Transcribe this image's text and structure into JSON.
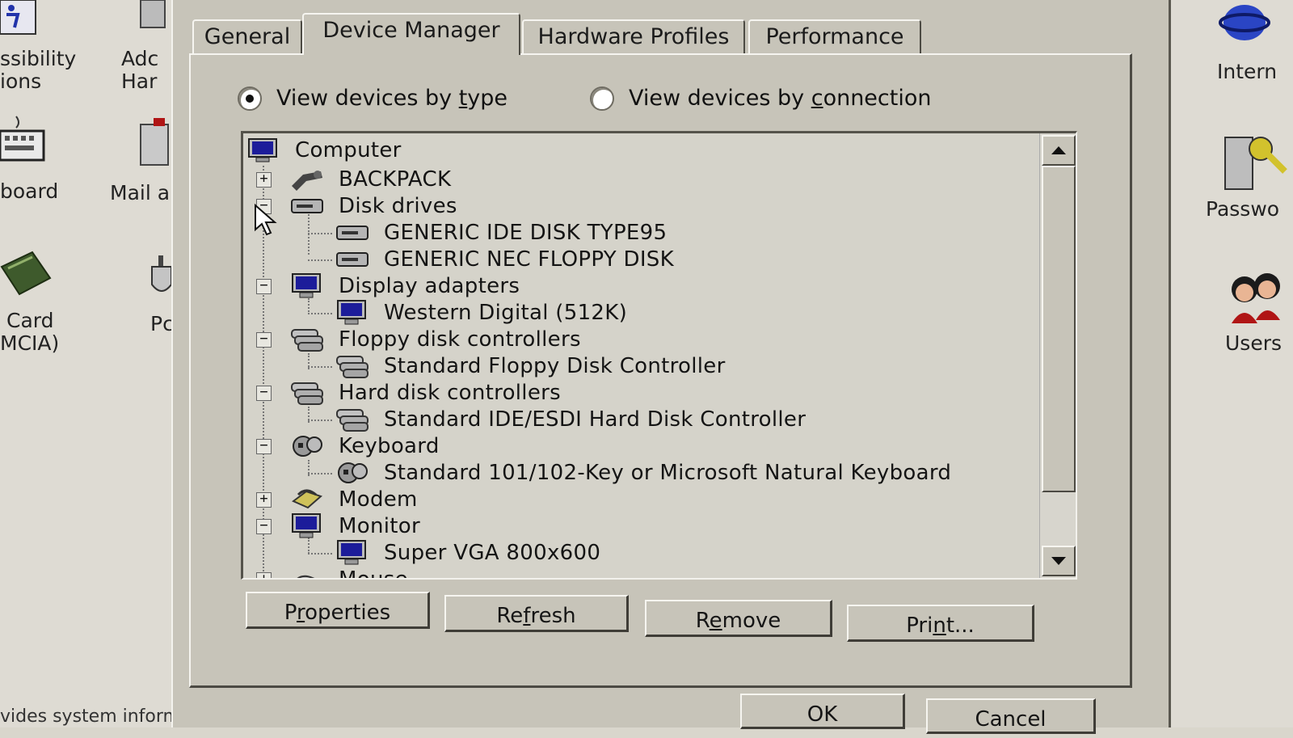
{
  "desktop": {
    "left_items": [
      {
        "label_top": "ssibility",
        "label_bottom": "ions",
        "icon": "accessibility-icon"
      },
      {
        "label_top": "Adc",
        "label_bottom": "Har",
        "icon": "add-hardware-icon"
      },
      {
        "label_top": "board",
        "label_bottom": "",
        "icon": "keyboard-icon"
      },
      {
        "label_top": "Mail a",
        "label_bottom": "",
        "icon": "mail-icon"
      },
      {
        "label_top": "Card",
        "label_bottom": "MCIA)",
        "icon": "pc-card-icon"
      },
      {
        "label_top": "Pc",
        "label_bottom": "",
        "icon": "power-icon"
      }
    ],
    "right_items": [
      {
        "label": "Intern",
        "icon": "internet-icon"
      },
      {
        "label": "Passwo",
        "icon": "passwords-icon"
      },
      {
        "label": "Users",
        "icon": "users-icon"
      }
    ],
    "status_text": "vides system inform"
  },
  "tabs": [
    {
      "label": "General",
      "active": false
    },
    {
      "label": "Device Manager",
      "active": true
    },
    {
      "label": "Hardware Profiles",
      "active": false
    },
    {
      "label": "Performance",
      "active": false
    }
  ],
  "view_options": {
    "by_type": {
      "prefix": "View devices by ",
      "underlined": "t",
      "suffix": "ype",
      "selected": true
    },
    "by_connection": {
      "prefix": "View devices by ",
      "underlined": "c",
      "suffix": "onnection",
      "selected": false
    }
  },
  "tree": {
    "root": "Computer",
    "rows": [
      {
        "label": "BACKPACK",
        "level": 1,
        "expander": "+",
        "icon": "backpack-icon"
      },
      {
        "label": "Disk drives",
        "level": 1,
        "expander": "−",
        "icon": "disk-drive-icon"
      },
      {
        "label": "GENERIC IDE  DISK TYPE95",
        "level": 2,
        "icon": "disk-drive-icon"
      },
      {
        "label": "GENERIC NEC  FLOPPY DISK",
        "level": 2,
        "icon": "disk-drive-icon"
      },
      {
        "label": "Display adapters",
        "level": 1,
        "expander": "−",
        "icon": "monitor-icon"
      },
      {
        "label": "Western Digital (512K)",
        "level": 2,
        "icon": "monitor-icon"
      },
      {
        "label": "Floppy disk controllers",
        "level": 1,
        "expander": "−",
        "icon": "controller-icon"
      },
      {
        "label": "Standard Floppy Disk Controller",
        "level": 2,
        "icon": "controller-icon"
      },
      {
        "label": "Hard disk controllers",
        "level": 1,
        "expander": "−",
        "icon": "controller-icon"
      },
      {
        "label": "Standard IDE/ESDI Hard Disk Controller",
        "level": 2,
        "icon": "controller-icon"
      },
      {
        "label": "Keyboard",
        "level": 1,
        "expander": "−",
        "icon": "keyboard-device-icon"
      },
      {
        "label": "Standard 101/102-Key or Microsoft Natural Keyboard",
        "level": 2,
        "icon": "keyboard-device-icon"
      },
      {
        "label": "Modem",
        "level": 1,
        "expander": "+",
        "icon": "modem-icon"
      },
      {
        "label": "Monitor",
        "level": 1,
        "expander": "−",
        "icon": "monitor-icon"
      },
      {
        "label": "Super VGA  800x600",
        "level": 2,
        "icon": "monitor-icon"
      },
      {
        "label": "Mouse",
        "level": 1,
        "expander": "+",
        "icon": "mouse-icon"
      }
    ]
  },
  "buttons": {
    "properties": {
      "prefix": "P",
      "underlined": "r",
      "suffix": "operties"
    },
    "refresh": {
      "prefix": "Re",
      "underlined": "f",
      "suffix": "resh"
    },
    "remove": {
      "prefix": "R",
      "underlined": "e",
      "suffix": "move"
    },
    "print": {
      "prefix": "Pri",
      "underlined": "n",
      "suffix": "t..."
    },
    "ok": "OK",
    "cancel": "Cancel"
  },
  "colors": {
    "face": "#c7c4b9",
    "tree_bg": "#d5d3ca",
    "monitor_screen": "#1c1c9a"
  }
}
